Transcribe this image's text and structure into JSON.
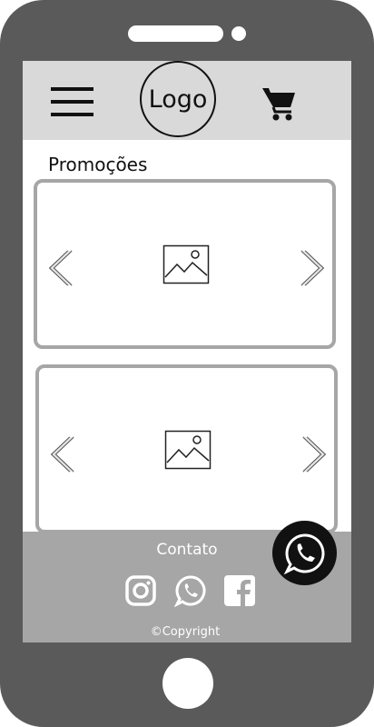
{
  "header": {
    "menu_icon": "hamburger-menu-icon",
    "logo_label": "Logo",
    "cart_icon": "shopping-cart-icon"
  },
  "main": {
    "section_title": "Promoções",
    "carousels": [
      {
        "prev_icon": "chevron-left-icon",
        "image_icon": "image-placeholder-icon",
        "next_icon": "chevron-right-icon"
      },
      {
        "prev_icon": "chevron-left-icon",
        "image_icon": "image-placeholder-icon",
        "next_icon": "chevron-right-icon"
      }
    ]
  },
  "footer": {
    "contact_title": "Contato",
    "social_icons": [
      "instagram-icon",
      "whatsapp-icon",
      "facebook-icon"
    ],
    "copyright": "©Copyright"
  },
  "floating_button": {
    "icon": "whatsapp-icon"
  },
  "colors": {
    "phone_body": "#5a5a5a",
    "header_bg": "#d9d9d9",
    "footer_bg": "#a6a6a6",
    "carousel_border": "#a6a6a6",
    "floating_button_bg": "#111111"
  }
}
